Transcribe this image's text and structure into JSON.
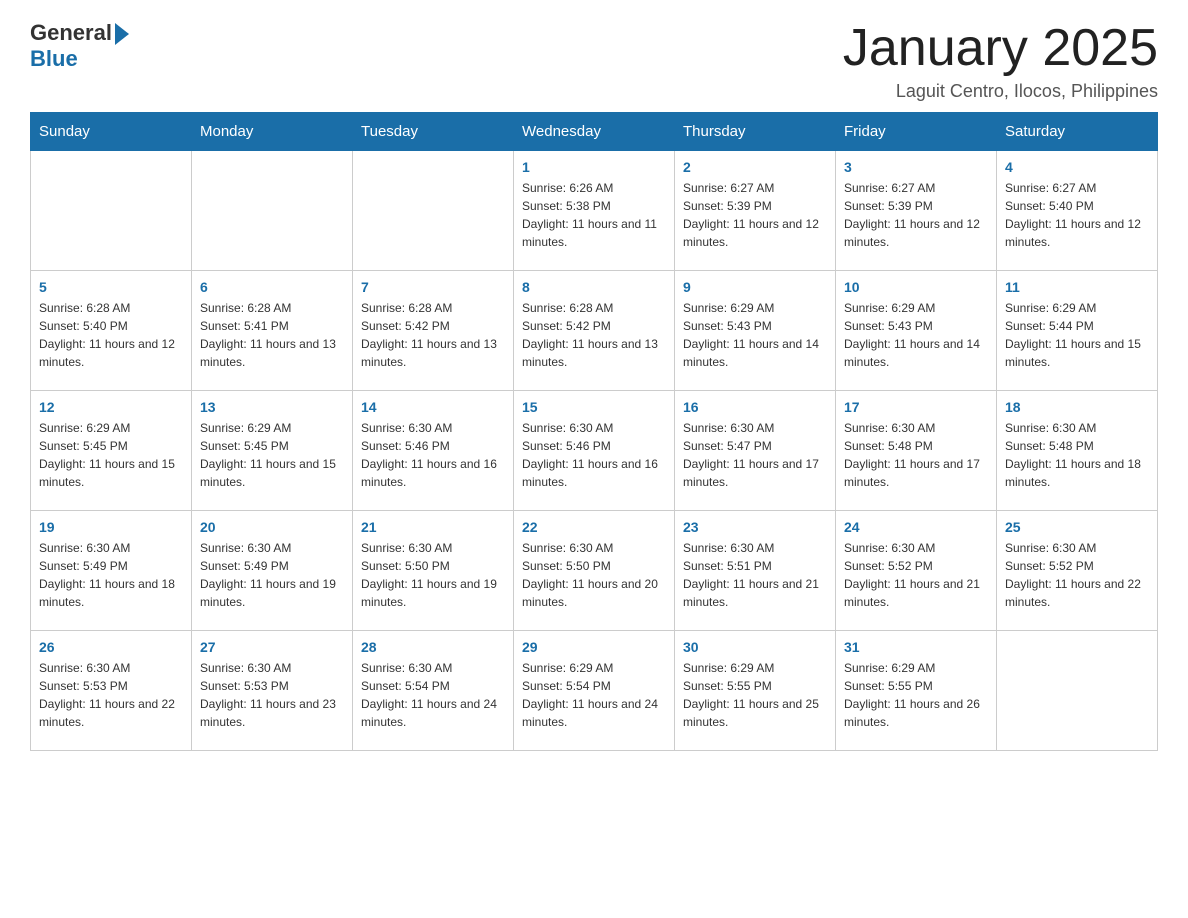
{
  "logo": {
    "text_general": "General",
    "text_blue": "Blue"
  },
  "header": {
    "month_title": "January 2025",
    "location": "Laguit Centro, Ilocos, Philippines"
  },
  "weekdays": [
    "Sunday",
    "Monday",
    "Tuesday",
    "Wednesday",
    "Thursday",
    "Friday",
    "Saturday"
  ],
  "weeks": [
    [
      {
        "day": "",
        "info": ""
      },
      {
        "day": "",
        "info": ""
      },
      {
        "day": "",
        "info": ""
      },
      {
        "day": "1",
        "info": "Sunrise: 6:26 AM\nSunset: 5:38 PM\nDaylight: 11 hours and 11 minutes."
      },
      {
        "day": "2",
        "info": "Sunrise: 6:27 AM\nSunset: 5:39 PM\nDaylight: 11 hours and 12 minutes."
      },
      {
        "day": "3",
        "info": "Sunrise: 6:27 AM\nSunset: 5:39 PM\nDaylight: 11 hours and 12 minutes."
      },
      {
        "day": "4",
        "info": "Sunrise: 6:27 AM\nSunset: 5:40 PM\nDaylight: 11 hours and 12 minutes."
      }
    ],
    [
      {
        "day": "5",
        "info": "Sunrise: 6:28 AM\nSunset: 5:40 PM\nDaylight: 11 hours and 12 minutes."
      },
      {
        "day": "6",
        "info": "Sunrise: 6:28 AM\nSunset: 5:41 PM\nDaylight: 11 hours and 13 minutes."
      },
      {
        "day": "7",
        "info": "Sunrise: 6:28 AM\nSunset: 5:42 PM\nDaylight: 11 hours and 13 minutes."
      },
      {
        "day": "8",
        "info": "Sunrise: 6:28 AM\nSunset: 5:42 PM\nDaylight: 11 hours and 13 minutes."
      },
      {
        "day": "9",
        "info": "Sunrise: 6:29 AM\nSunset: 5:43 PM\nDaylight: 11 hours and 14 minutes."
      },
      {
        "day": "10",
        "info": "Sunrise: 6:29 AM\nSunset: 5:43 PM\nDaylight: 11 hours and 14 minutes."
      },
      {
        "day": "11",
        "info": "Sunrise: 6:29 AM\nSunset: 5:44 PM\nDaylight: 11 hours and 15 minutes."
      }
    ],
    [
      {
        "day": "12",
        "info": "Sunrise: 6:29 AM\nSunset: 5:45 PM\nDaylight: 11 hours and 15 minutes."
      },
      {
        "day": "13",
        "info": "Sunrise: 6:29 AM\nSunset: 5:45 PM\nDaylight: 11 hours and 15 minutes."
      },
      {
        "day": "14",
        "info": "Sunrise: 6:30 AM\nSunset: 5:46 PM\nDaylight: 11 hours and 16 minutes."
      },
      {
        "day": "15",
        "info": "Sunrise: 6:30 AM\nSunset: 5:46 PM\nDaylight: 11 hours and 16 minutes."
      },
      {
        "day": "16",
        "info": "Sunrise: 6:30 AM\nSunset: 5:47 PM\nDaylight: 11 hours and 17 minutes."
      },
      {
        "day": "17",
        "info": "Sunrise: 6:30 AM\nSunset: 5:48 PM\nDaylight: 11 hours and 17 minutes."
      },
      {
        "day": "18",
        "info": "Sunrise: 6:30 AM\nSunset: 5:48 PM\nDaylight: 11 hours and 18 minutes."
      }
    ],
    [
      {
        "day": "19",
        "info": "Sunrise: 6:30 AM\nSunset: 5:49 PM\nDaylight: 11 hours and 18 minutes."
      },
      {
        "day": "20",
        "info": "Sunrise: 6:30 AM\nSunset: 5:49 PM\nDaylight: 11 hours and 19 minutes."
      },
      {
        "day": "21",
        "info": "Sunrise: 6:30 AM\nSunset: 5:50 PM\nDaylight: 11 hours and 19 minutes."
      },
      {
        "day": "22",
        "info": "Sunrise: 6:30 AM\nSunset: 5:50 PM\nDaylight: 11 hours and 20 minutes."
      },
      {
        "day": "23",
        "info": "Sunrise: 6:30 AM\nSunset: 5:51 PM\nDaylight: 11 hours and 21 minutes."
      },
      {
        "day": "24",
        "info": "Sunrise: 6:30 AM\nSunset: 5:52 PM\nDaylight: 11 hours and 21 minutes."
      },
      {
        "day": "25",
        "info": "Sunrise: 6:30 AM\nSunset: 5:52 PM\nDaylight: 11 hours and 22 minutes."
      }
    ],
    [
      {
        "day": "26",
        "info": "Sunrise: 6:30 AM\nSunset: 5:53 PM\nDaylight: 11 hours and 22 minutes."
      },
      {
        "day": "27",
        "info": "Sunrise: 6:30 AM\nSunset: 5:53 PM\nDaylight: 11 hours and 23 minutes."
      },
      {
        "day": "28",
        "info": "Sunrise: 6:30 AM\nSunset: 5:54 PM\nDaylight: 11 hours and 24 minutes."
      },
      {
        "day": "29",
        "info": "Sunrise: 6:29 AM\nSunset: 5:54 PM\nDaylight: 11 hours and 24 minutes."
      },
      {
        "day": "30",
        "info": "Sunrise: 6:29 AM\nSunset: 5:55 PM\nDaylight: 11 hours and 25 minutes."
      },
      {
        "day": "31",
        "info": "Sunrise: 6:29 AM\nSunset: 5:55 PM\nDaylight: 11 hours and 26 minutes."
      },
      {
        "day": "",
        "info": ""
      }
    ]
  ]
}
